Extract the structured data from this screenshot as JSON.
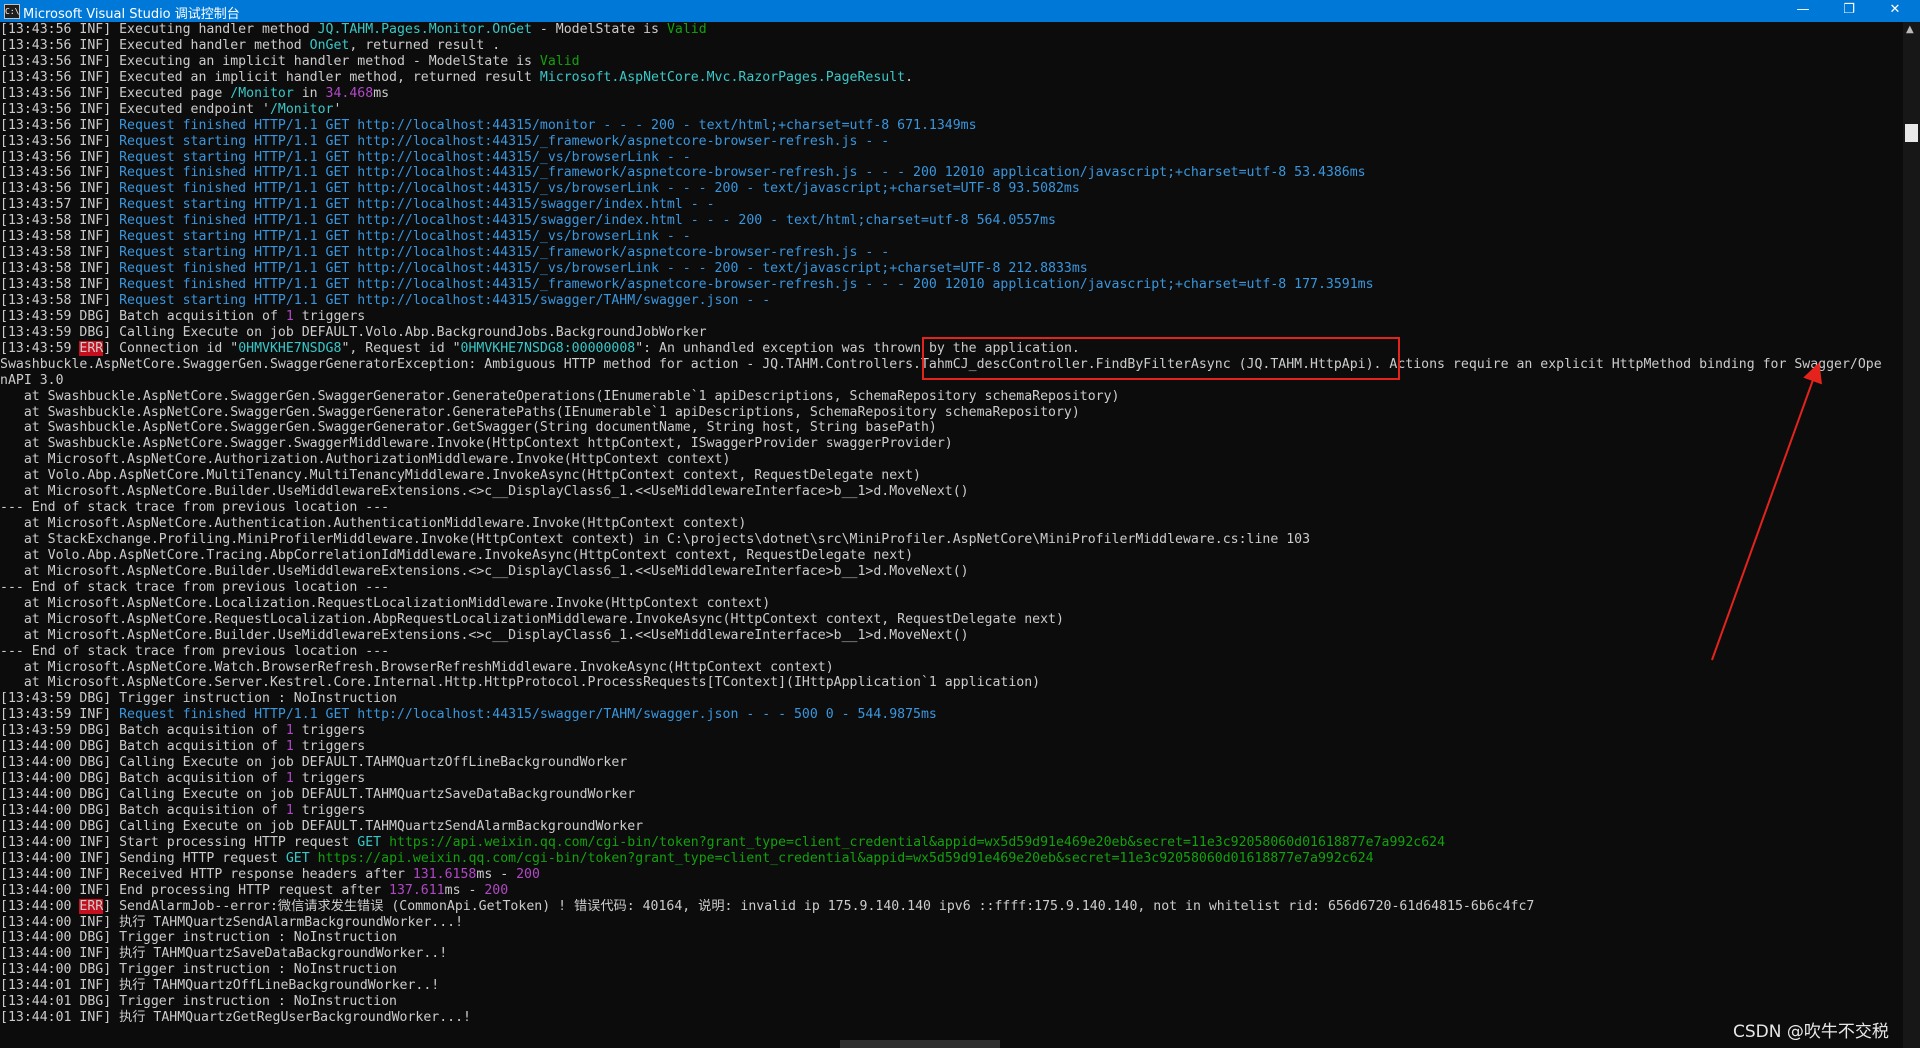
{
  "window": {
    "title": "Microsoft Visual Studio 调试控制台",
    "icon_label": "C:\\",
    "controls": {
      "minimize": "—",
      "maximize": "❐",
      "close": "✕"
    }
  },
  "console": {
    "lines": [
      [
        {
          "t": "[13:43:56 INF] Executing handler method "
        },
        {
          "t": "JQ.TAHM.Pages.Monitor.OnGet",
          "c": "teal"
        },
        {
          "t": " - ModelState is "
        },
        {
          "t": "Valid",
          "c": "green"
        }
      ],
      [
        {
          "t": "[13:43:56 INF] Executed handler method "
        },
        {
          "t": "OnGet",
          "c": "teal"
        },
        {
          "t": ", returned result ."
        }
      ],
      [
        {
          "t": "[13:43:56 INF] Executing an implicit handler method - ModelState is "
        },
        {
          "t": "Valid",
          "c": "green"
        }
      ],
      [
        {
          "t": "[13:43:56 INF] Executed an implicit handler method, returned result "
        },
        {
          "t": "Microsoft.AspNetCore.Mvc.RazorPages.PageResult",
          "c": "teal"
        },
        {
          "t": "."
        }
      ],
      [
        {
          "t": "[13:43:56 INF] Executed page "
        },
        {
          "t": "/Monitor",
          "c": "teal"
        },
        {
          "t": " in "
        },
        {
          "t": "34.468",
          "c": "mag"
        },
        {
          "t": "ms"
        }
      ],
      [
        {
          "t": "[13:43:56 INF] Executed endpoint '"
        },
        {
          "t": "/Monitor",
          "c": "teal"
        },
        {
          "t": "'"
        }
      ],
      [
        {
          "t": "[13:43:56 INF] "
        },
        {
          "t": "Request finished HTTP/1.1 GET http://localhost:44315/monitor - - - 200 - text/html;+charset=utf-8 671.1349ms",
          "c": "cyan"
        }
      ],
      [
        {
          "t": "[13:43:56 INF] "
        },
        {
          "t": "Request starting HTTP/1.1 GET http://localhost:44315/_framework/aspnetcore-browser-refresh.js - -",
          "c": "cyan"
        }
      ],
      [
        {
          "t": "[13:43:56 INF] "
        },
        {
          "t": "Request starting HTTP/1.1 GET http://localhost:44315/_vs/browserLink - -",
          "c": "cyan"
        }
      ],
      [
        {
          "t": "[13:43:56 INF] "
        },
        {
          "t": "Request finished HTTP/1.1 GET http://localhost:44315/_framework/aspnetcore-browser-refresh.js - - - 200 12010 application/javascript;+charset=utf-8 53.4386ms",
          "c": "cyan"
        }
      ],
      [
        {
          "t": "[13:43:56 INF] "
        },
        {
          "t": "Request finished HTTP/1.1 GET http://localhost:44315/_vs/browserLink - - - 200 - text/javascript;+charset=UTF-8 93.5082ms",
          "c": "cyan"
        }
      ],
      [
        {
          "t": "[13:43:57 INF] "
        },
        {
          "t": "Request starting HTTP/1.1 GET http://localhost:44315/swagger/index.html - -",
          "c": "cyan"
        }
      ],
      [
        {
          "t": "[13:43:58 INF] "
        },
        {
          "t": "Request finished HTTP/1.1 GET http://localhost:44315/swagger/index.html - - - 200 - text/html;charset=utf-8 564.0557ms",
          "c": "cyan"
        }
      ],
      [
        {
          "t": "[13:43:58 INF] "
        },
        {
          "t": "Request starting HTTP/1.1 GET http://localhost:44315/_vs/browserLink - -",
          "c": "cyan"
        }
      ],
      [
        {
          "t": "[13:43:58 INF] "
        },
        {
          "t": "Request starting HTTP/1.1 GET http://localhost:44315/_framework/aspnetcore-browser-refresh.js - -",
          "c": "cyan"
        }
      ],
      [
        {
          "t": "[13:43:58 INF] "
        },
        {
          "t": "Request finished HTTP/1.1 GET http://localhost:44315/_vs/browserLink - - - 200 - text/javascript;+charset=UTF-8 212.8833ms",
          "c": "cyan"
        }
      ],
      [
        {
          "t": "[13:43:58 INF] "
        },
        {
          "t": "Request finished HTTP/1.1 GET http://localhost:44315/_framework/aspnetcore-browser-refresh.js - - - 200 12010 application/javascript;+charset=utf-8 177.3591ms",
          "c": "cyan"
        }
      ],
      [
        {
          "t": "[13:43:58 INF] "
        },
        {
          "t": "Request starting HTTP/1.1 GET http://localhost:44315/swagger/TAHM/swagger.json - -",
          "c": "cyan"
        }
      ],
      [
        {
          "t": "[13:43:59 DBG] Batch acquisition of "
        },
        {
          "t": "1",
          "c": "mag"
        },
        {
          "t": " triggers"
        }
      ],
      [
        {
          "t": "[13:43:59 DBG] Calling Execute on job DEFAULT.Volo.Abp.BackgroundJobs.BackgroundJobWorker"
        }
      ],
      [
        {
          "t": "[13:43:59 "
        },
        {
          "t": "ERR",
          "c": "err"
        },
        {
          "t": "] Connection id \""
        },
        {
          "t": "0HMVKHE7NSDG8",
          "c": "teal"
        },
        {
          "t": "\", Request id \""
        },
        {
          "t": "0HMVKHE7NSDG8:00000008",
          "c": "teal"
        },
        {
          "t": "\": An unhandled exception was thrown by the application."
        }
      ],
      [
        {
          "t": "Swashbuckle.AspNetCore.SwaggerGen.SwaggerGeneratorException: Ambiguous HTTP method for action - JQ.TAHM.Controllers.TahmCJ_descController.FindByFilterAsync (JQ.TAHM.HttpApi). Actions require an explicit HttpMethod binding for Swagger/Ope"
        }
      ],
      [
        {
          "t": "nAPI 3.0"
        }
      ],
      [
        {
          "t": "   at Swashbuckle.AspNetCore.SwaggerGen.SwaggerGenerator.GenerateOperations(IEnumerable`1 apiDescriptions, SchemaRepository schemaRepository)"
        }
      ],
      [
        {
          "t": "   at Swashbuckle.AspNetCore.SwaggerGen.SwaggerGenerator.GeneratePaths(IEnumerable`1 apiDescriptions, SchemaRepository schemaRepository)"
        }
      ],
      [
        {
          "t": "   at Swashbuckle.AspNetCore.SwaggerGen.SwaggerGenerator.GetSwagger(String documentName, String host, String basePath)"
        }
      ],
      [
        {
          "t": "   at Swashbuckle.AspNetCore.Swagger.SwaggerMiddleware.Invoke(HttpContext httpContext, ISwaggerProvider swaggerProvider)"
        }
      ],
      [
        {
          "t": "   at Microsoft.AspNetCore.Authorization.AuthorizationMiddleware.Invoke(HttpContext context)"
        }
      ],
      [
        {
          "t": "   at Volo.Abp.AspNetCore.MultiTenancy.MultiTenancyMiddleware.InvokeAsync(HttpContext context, RequestDelegate next)"
        }
      ],
      [
        {
          "t": "   at Microsoft.AspNetCore.Builder.UseMiddlewareExtensions.<>c__DisplayClass6_1.<<UseMiddlewareInterface>b__1>d.MoveNext()"
        }
      ],
      [
        {
          "t": "--- End of stack trace from previous location ---"
        }
      ],
      [
        {
          "t": "   at Microsoft.AspNetCore.Authentication.AuthenticationMiddleware.Invoke(HttpContext context)"
        }
      ],
      [
        {
          "t": "   at StackExchange.Profiling.MiniProfilerMiddleware.Invoke(HttpContext context) in C:\\projects\\dotnet\\src\\MiniProfiler.AspNetCore\\MiniProfilerMiddleware.cs:line 103"
        }
      ],
      [
        {
          "t": "   at Volo.Abp.AspNetCore.Tracing.AbpCorrelationIdMiddleware.InvokeAsync(HttpContext context, RequestDelegate next)"
        }
      ],
      [
        {
          "t": "   at Microsoft.AspNetCore.Builder.UseMiddlewareExtensions.<>c__DisplayClass6_1.<<UseMiddlewareInterface>b__1>d.MoveNext()"
        }
      ],
      [
        {
          "t": "--- End of stack trace from previous location ---"
        }
      ],
      [
        {
          "t": "   at Microsoft.AspNetCore.Localization.RequestLocalizationMiddleware.Invoke(HttpContext context)"
        }
      ],
      [
        {
          "t": "   at Microsoft.AspNetCore.RequestLocalization.AbpRequestLocalizationMiddleware.InvokeAsync(HttpContext context, RequestDelegate next)"
        }
      ],
      [
        {
          "t": "   at Microsoft.AspNetCore.Builder.UseMiddlewareExtensions.<>c__DisplayClass6_1.<<UseMiddlewareInterface>b__1>d.MoveNext()"
        }
      ],
      [
        {
          "t": "--- End of stack trace from previous location ---"
        }
      ],
      [
        {
          "t": "   at Microsoft.AspNetCore.Watch.BrowserRefresh.BrowserRefreshMiddleware.InvokeAsync(HttpContext context)"
        }
      ],
      [
        {
          "t": "   at Microsoft.AspNetCore.Server.Kestrel.Core.Internal.Http.HttpProtocol.ProcessRequests[TContext](IHttpApplication`1 application)"
        }
      ],
      [
        {
          "t": "[13:43:59 DBG] Trigger instruction : NoInstruction"
        }
      ],
      [
        {
          "t": "[13:43:59 INF] "
        },
        {
          "t": "Request finished HTTP/1.1 GET http://localhost:44315/swagger/TAHM/swagger.json - - - 500 0 - 544.9875ms",
          "c": "cyan"
        }
      ],
      [
        {
          "t": "[13:43:59 DBG] Batch acquisition of "
        },
        {
          "t": "1",
          "c": "mag"
        },
        {
          "t": " triggers"
        }
      ],
      [
        {
          "t": "[13:44:00 DBG] Batch acquisition of "
        },
        {
          "t": "1",
          "c": "mag"
        },
        {
          "t": " triggers"
        }
      ],
      [
        {
          "t": "[13:44:00 DBG] Calling Execute on job DEFAULT.TAHMQuartzOffLineBackgroundWorker"
        }
      ],
      [
        {
          "t": "[13:44:00 DBG] Batch acquisition of "
        },
        {
          "t": "1",
          "c": "mag"
        },
        {
          "t": " triggers"
        }
      ],
      [
        {
          "t": "[13:44:00 DBG] Calling Execute on job DEFAULT.TAHMQuartzSaveDataBackgroundWorker"
        }
      ],
      [
        {
          "t": "[13:44:00 DBG] Batch acquisition of "
        },
        {
          "t": "1",
          "c": "mag"
        },
        {
          "t": " triggers"
        }
      ],
      [
        {
          "t": "[13:44:00 DBG] Calling Execute on job DEFAULT.TAHMQuartzSendAlarmBackgroundWorker"
        }
      ],
      [
        {
          "t": "[13:44:00 INF] Start processing HTTP request "
        },
        {
          "t": "GET",
          "c": "teal"
        },
        {
          "t": " "
        },
        {
          "t": "https://api.weixin.qq.com/cgi-bin/token?grant_type=client_credential&appid=wx5d59d91e469e20eb&secret=11e3c92058060d01618877e7a992c624",
          "c": "green"
        }
      ],
      [
        {
          "t": "[13:44:00 INF] Sending HTTP request "
        },
        {
          "t": "GET",
          "c": "teal"
        },
        {
          "t": " "
        },
        {
          "t": "https://api.weixin.qq.com/cgi-bin/token?grant_type=client_credential&appid=wx5d59d91e469e20eb&secret=11e3c92058060d01618877e7a992c624",
          "c": "green"
        }
      ],
      [
        {
          "t": "[13:44:00 INF] Received HTTP response headers after "
        },
        {
          "t": "131.6158",
          "c": "mag"
        },
        {
          "t": "ms - "
        },
        {
          "t": "200",
          "c": "mag"
        }
      ],
      [
        {
          "t": "[13:44:00 INF] End processing HTTP request after "
        },
        {
          "t": "137.611",
          "c": "mag"
        },
        {
          "t": "ms - "
        },
        {
          "t": "200",
          "c": "mag"
        }
      ],
      [
        {
          "t": "[13:44:00 "
        },
        {
          "t": "ERR",
          "c": "err"
        },
        {
          "t": "] SendAlarmJob--error:微信请求发生错误 (CommonApi.GetToken) ! 错误代码: 40164, 说明: invalid ip 175.9.140.140 ipv6 ::ffff:175.9.140.140, not in whitelist rid: 656d6720-61d64815-6b6c4fc7"
        }
      ],
      [
        {
          "t": "[13:44:00 INF] 执行 TAHMQuartzSendAlarmBackgroundWorker...!"
        }
      ],
      [
        {
          "t": "[13:44:00 DBG] Trigger instruction : NoInstruction"
        }
      ],
      [
        {
          "t": "[13:44:00 INF] 执行 TAHMQuartzSaveDataBackgroundWorker..!"
        }
      ],
      [
        {
          "t": "[13:44:00 DBG] Trigger instruction : NoInstruction"
        }
      ],
      [
        {
          "t": "[13:44:01 INF] 执行 TAHMQuartzOffLineBackgroundWorker..!"
        }
      ],
      [
        {
          "t": "[13:44:01 DBG] Trigger instruction : NoInstruction"
        }
      ],
      [
        {
          "t": "[13:44:01 INF] 执行 TAHMQuartzGetRegUserBackgroundWorker...!"
        }
      ]
    ]
  },
  "watermark": "CSDN @吹牛不交税",
  "colors": {
    "titlebar": "#0078d7",
    "background": "#0c0c0c",
    "text": "#cccccc",
    "request": "#3a96dd",
    "identifier": "#3ac7c7",
    "url": "#13a10e",
    "number": "#b148c6",
    "error_badge": "#c50f1f",
    "annotation": "#e5231d"
  },
  "annotation": {
    "type": "red-rectangle-with-arrow"
  }
}
